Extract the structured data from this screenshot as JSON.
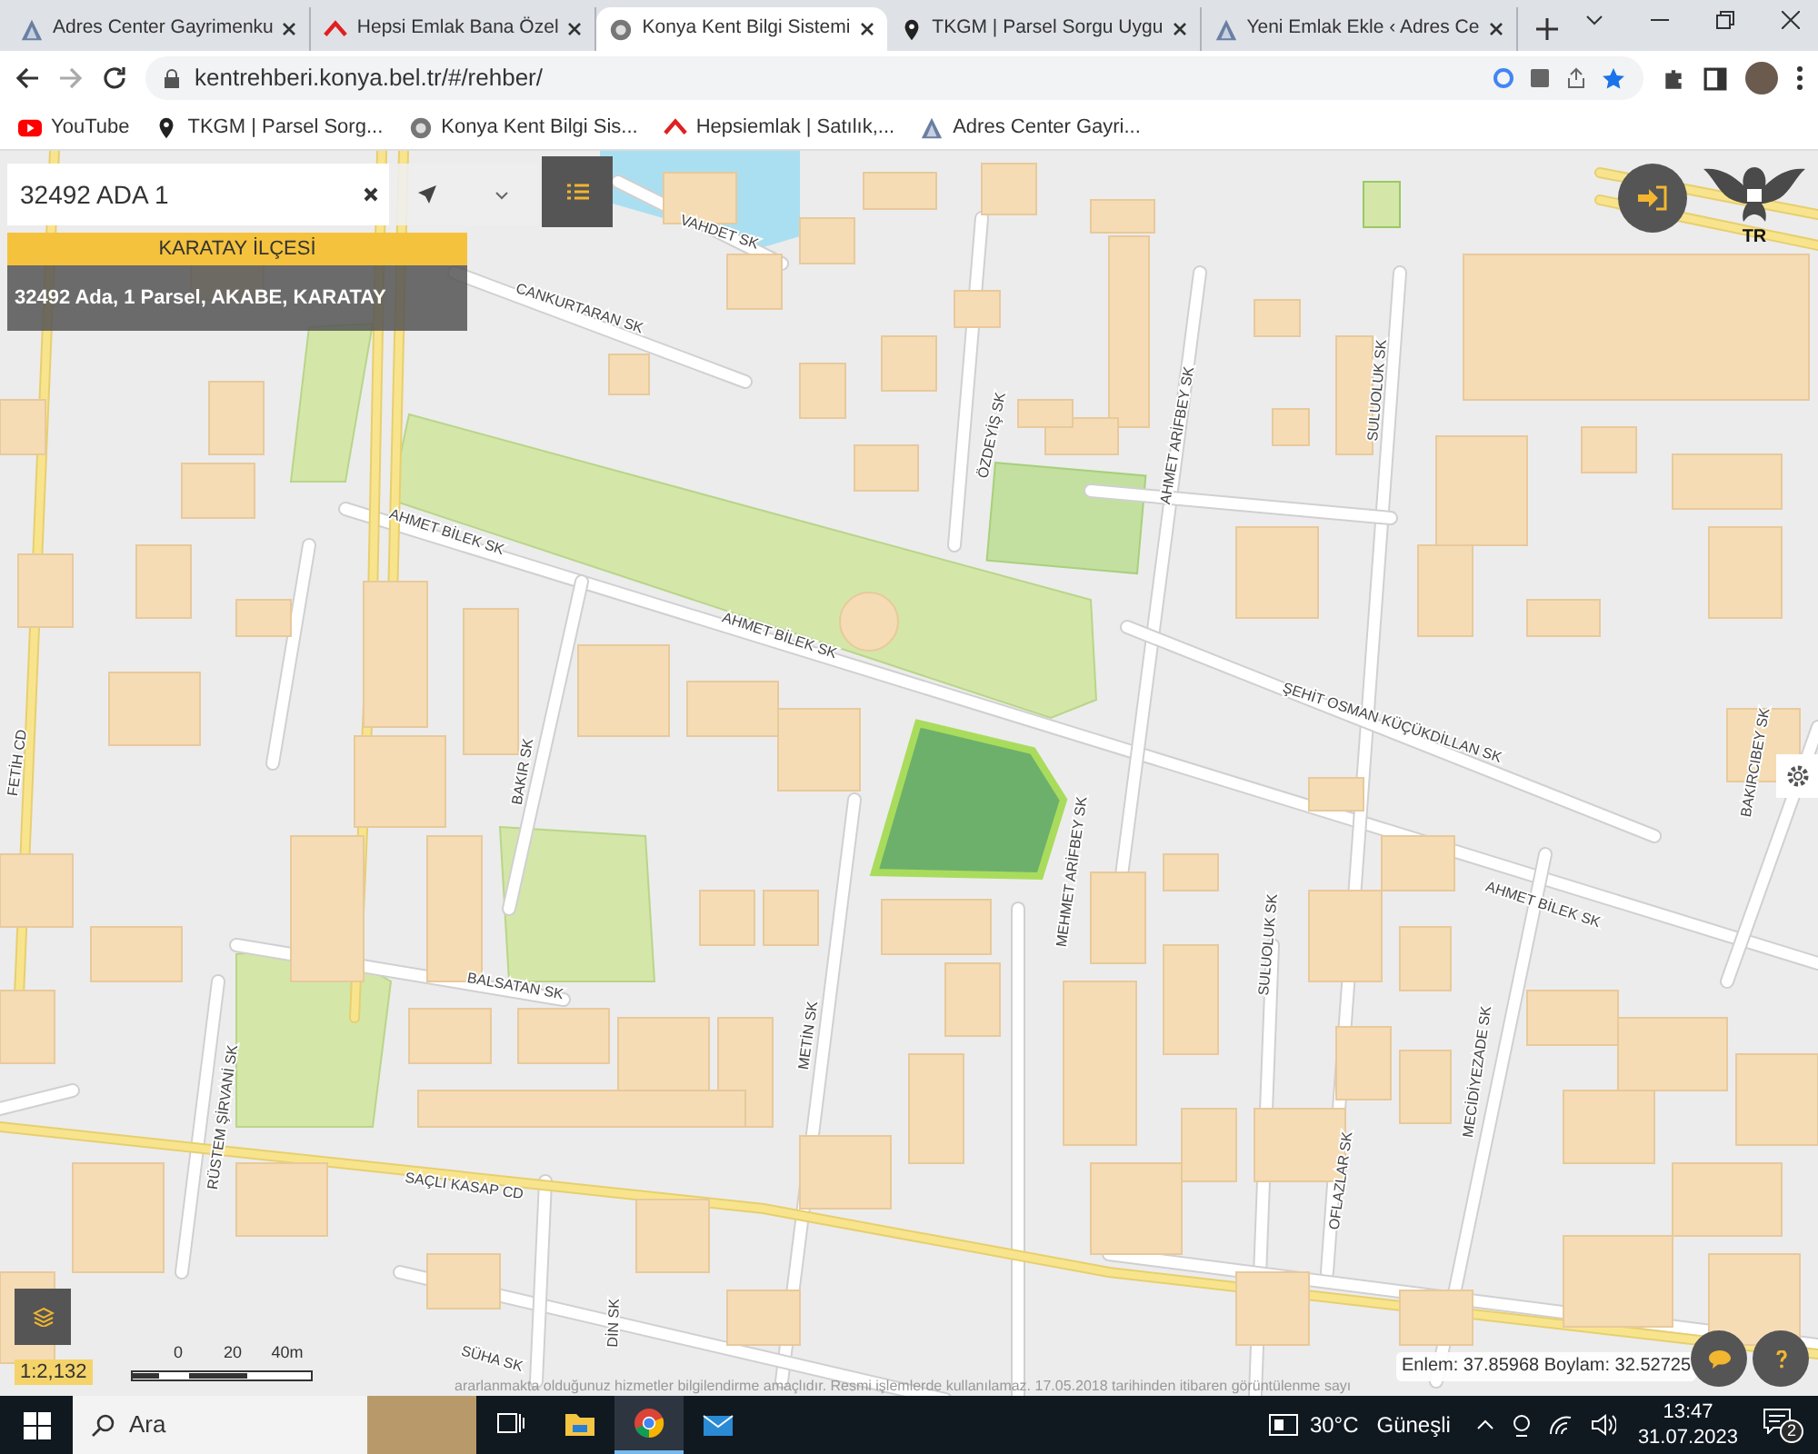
{
  "browser": {
    "tabs": [
      {
        "title": "Adres Center Gayrimenku",
        "kind": "triangle",
        "selected": false
      },
      {
        "title": "Hepsi Emlak Bana Özel",
        "kind": "roof",
        "selected": false
      },
      {
        "title": "Konya Kent Bilgi Sistemi",
        "kind": "emblem",
        "selected": true
      },
      {
        "title": "TKGM | Parsel Sorgu Uygu",
        "kind": "pin",
        "selected": false
      },
      {
        "title": "Yeni Emlak Ekle ‹ Adres Ce",
        "kind": "triangle",
        "selected": false
      }
    ],
    "url": "kentrehberi.konya.bel.tr/#/rehber/",
    "bookmarks": [
      {
        "label": "YouTube",
        "kind": "youtube"
      },
      {
        "label": "TKGM | Parsel Sorg...",
        "kind": "pin"
      },
      {
        "label": "Konya Kent Bilgi Sis...",
        "kind": "emblem"
      },
      {
        "label": "Hepsiemlak | Satılık,...",
        "kind": "roof"
      },
      {
        "label": "Adres Center Gayri...",
        "kind": "triangle"
      }
    ]
  },
  "map": {
    "search": {
      "value": "32492 ADA 1"
    },
    "district": "KARATAY İLÇESİ",
    "result": "32492 Ada, 1 Parsel, AKABE, KARATAY",
    "emblem_label": "TR",
    "street_labels": [
      "VAHDET SK",
      "CANKURTARAN SK",
      "ÖZDEYİŞ SK",
      "AHMET ARİFBEY SK",
      "SULUOLUK SK",
      "AHMET BİLEK SK",
      "AHMET BİLEK SK",
      "ŞEHİT OSMAN KÜÇÜKDİLLAN SK",
      "BAKIRCIBEY SK",
      "BAKIR SK",
      "MEHMET ARİFBEY SK",
      "METİN SK",
      "SULUOLUK SK",
      "AHMET BİLEK SK",
      "BALSATAN SK",
      "RÜSTEM ŞİRVANİ SK",
      "SAÇLI KASAP CD",
      "OFLAZLAR SK",
      "MECİDİYEZADE SK",
      "SÜHA SK",
      "DİN SK",
      "FETİH CD"
    ],
    "scale": {
      "ratio": "1:2,132",
      "ticks": [
        "0",
        "20",
        "40m"
      ]
    },
    "attribution": "ararlanmakta olduğunuz hizmetler bilgilendirme amaçlıdır. Resmi işlemlerde kullanılamaz. 17.05.2018 tarihinden itibaren görüntülenme sayı",
    "coordinates": "Enlem: 37.85968 Boylam: 32.52725"
  },
  "taskbar": {
    "search_placeholder": "Ara",
    "apps": [
      {
        "kind": "taskview",
        "selected": false
      },
      {
        "kind": "explorer",
        "selected": false
      },
      {
        "kind": "chrome",
        "selected": true
      },
      {
        "kind": "mail",
        "selected": false
      }
    ],
    "weather": {
      "temperature": "30°C",
      "condition": "Güneşli"
    },
    "time": "13:47",
    "date": "31.07.2023",
    "notifications": "2"
  }
}
